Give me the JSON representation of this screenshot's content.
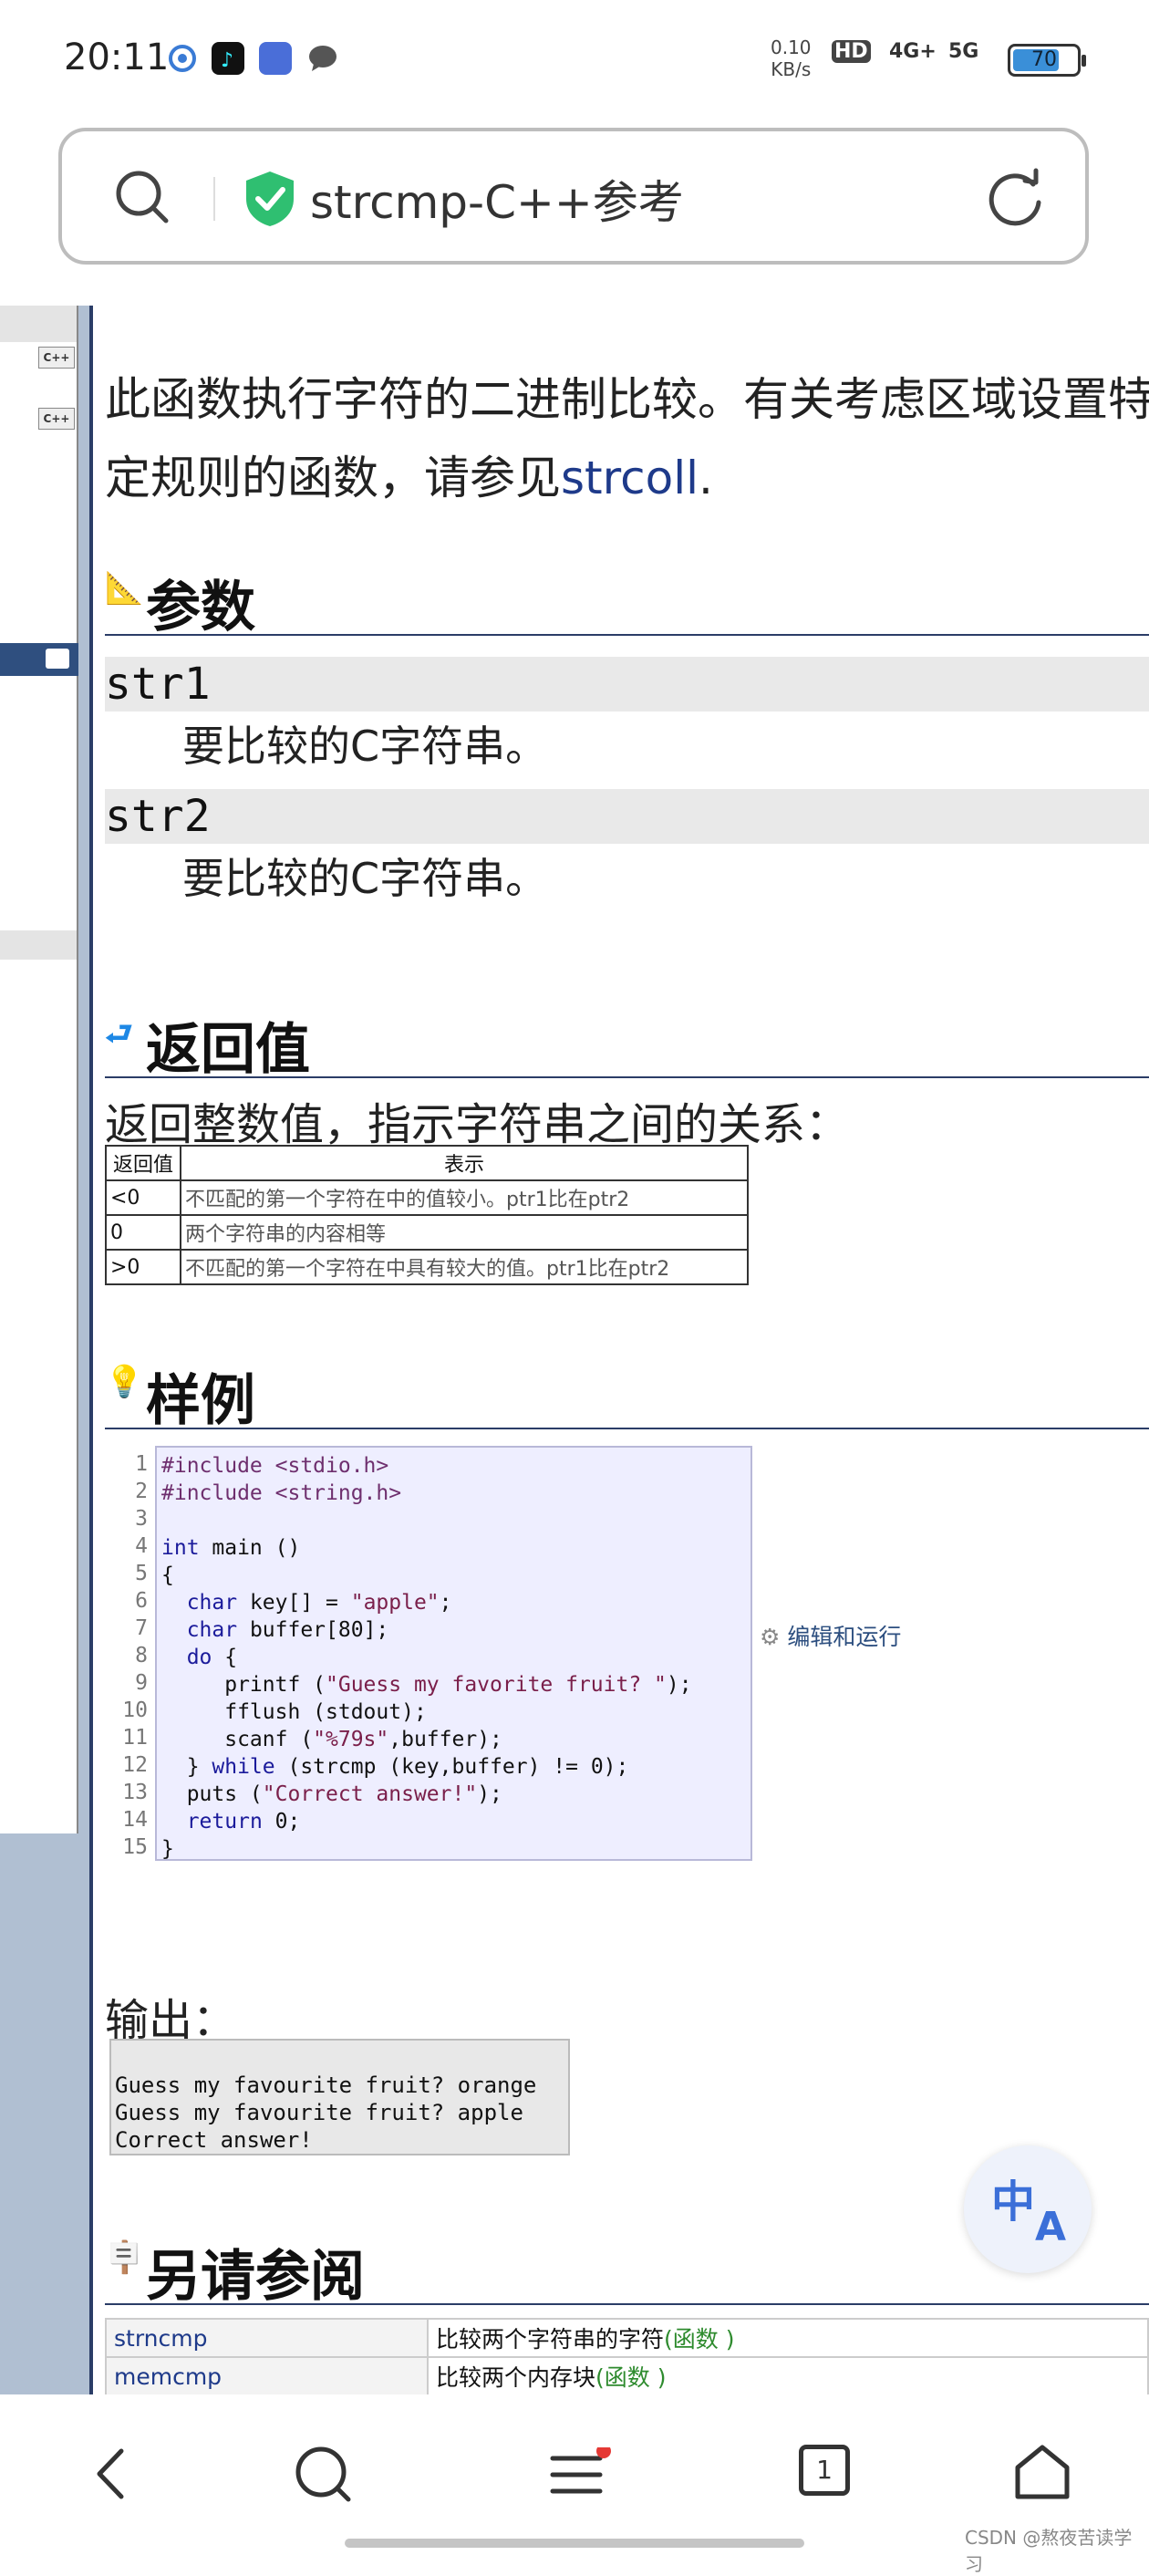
{
  "status_bar": {
    "time": "20:11",
    "net_speed_value": "0.10",
    "net_speed_unit": "KB/s",
    "hd_label": "HD",
    "signal_1": "4G+",
    "signal_2": "5G",
    "battery": "70"
  },
  "url_bar": {
    "title": "strcmp-C++参考"
  },
  "intro": {
    "line1": "此函数执行字符的二进制比较。有关考虑区域设置特",
    "line2_prefix": "定规则的函数，请参见",
    "line2_link": "strcoll",
    "line2_suffix": "."
  },
  "sections": {
    "params": "参数",
    "return": "返回值",
    "example": "样例",
    "see_also": "另请参阅"
  },
  "params": [
    {
      "name": "str1",
      "desc": "要比较的C字符串。"
    },
    {
      "name": "str2",
      "desc": "要比较的C字符串。"
    }
  ],
  "return_desc": "返回整数值，指示字符串之间的关系：",
  "return_table": {
    "headers": [
      "返回值",
      "表示"
    ],
    "rows": [
      {
        "value": "<0",
        "meaning": "不匹配的第一个字符在中的值较小。ptr1比在ptr2"
      },
      {
        "value": "0",
        "meaning": "两个字符串的内容相等"
      },
      {
        "value": ">0",
        "meaning": "不匹配的第一个字符在中具有较大的值。ptr1比在ptr2"
      }
    ]
  },
  "code_lines": [
    "#include <stdio.h>",
    "#include <string.h>",
    "",
    "int main ()",
    "{",
    "  char key[] = \"apple\";",
    "  char buffer[80];",
    "  do {",
    "     printf (\"Guess my favorite fruit? \");",
    "     fflush (stdout);",
    "     scanf (\"%79s\",buffer);",
    "  } while (strcmp (key,buffer) != 0);",
    "  puts (\"Correct answer!\");",
    "  return 0;",
    "}"
  ],
  "run_link": "编辑和运行",
  "output_label": "输出：",
  "output_lines": [
    "Guess my favourite fruit? orange",
    "Guess my favourite fruit? apple",
    "Correct answer!"
  ],
  "see_also": [
    {
      "fn": "strncmp",
      "desc": "比较两个字符串的字符",
      "kind": "(函数 )"
    },
    {
      "fn": "memcmp",
      "desc": "比较两个内存块",
      "kind": "(函数 )"
    }
  ],
  "fab": {
    "top": "中",
    "bottom": "A"
  },
  "nav": {
    "tab_count": "1"
  },
  "watermark": "CSDN @熬夜苦读学习",
  "colors": {
    "link": "#1e3a8a",
    "accent_line": "#2b3d67",
    "code_bg": "#eeeeff",
    "shield": "#2fbf71"
  }
}
